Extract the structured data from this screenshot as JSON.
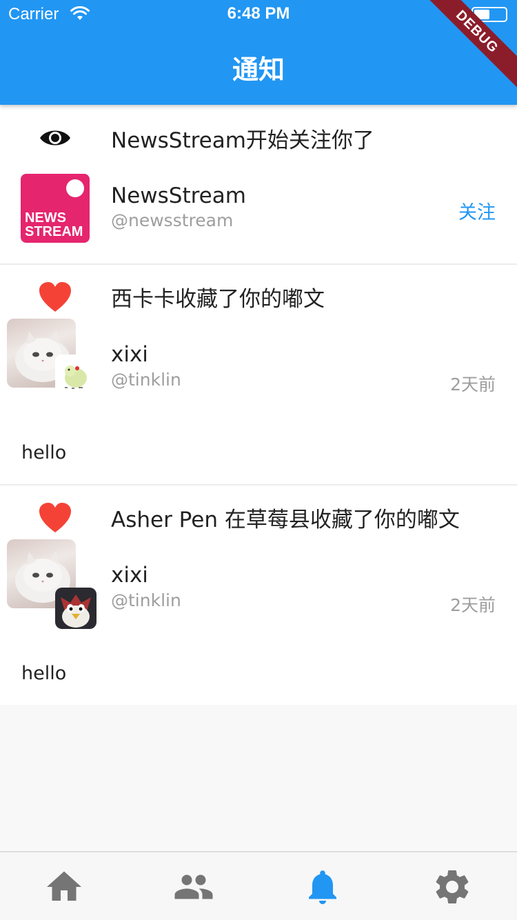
{
  "status_bar": {
    "carrier": "Carrier",
    "time": "6:48 PM",
    "wifi_icon": "wifi-icon",
    "battery_icon": "battery-icon"
  },
  "header": {
    "title": "通知",
    "debug_ribbon": "DEBUG",
    "color": "#2196f3"
  },
  "notifications": [
    {
      "type_icon": "eye-icon",
      "headline": "NewsStream开始关注你了",
      "user": {
        "name": "NewsStream",
        "handle": "@newsstream",
        "avatar_text": "NEWS\nSTREAM"
      },
      "action_label": "关注"
    },
    {
      "type_icon": "heart-icon",
      "headline": "西卡卡收藏了你的嘟文",
      "user": {
        "name": "xixi",
        "handle": "@tinklin"
      },
      "time": "2天前",
      "body": "hello"
    },
    {
      "type_icon": "heart-icon",
      "headline": "Asher Pen 在草莓县收藏了你的嘟文",
      "user": {
        "name": "xixi",
        "handle": "@tinklin"
      },
      "time": "2天前",
      "body": "hello"
    }
  ],
  "bottom_nav": {
    "items": [
      "home-icon",
      "people-icon",
      "bell-icon",
      "settings-icon"
    ],
    "active_index": 2,
    "active_color": "#2196f3",
    "inactive_color": "#757575"
  },
  "colors": {
    "accent": "#2196f3",
    "heart": "#f44336",
    "news_brand": "#e5256e"
  }
}
